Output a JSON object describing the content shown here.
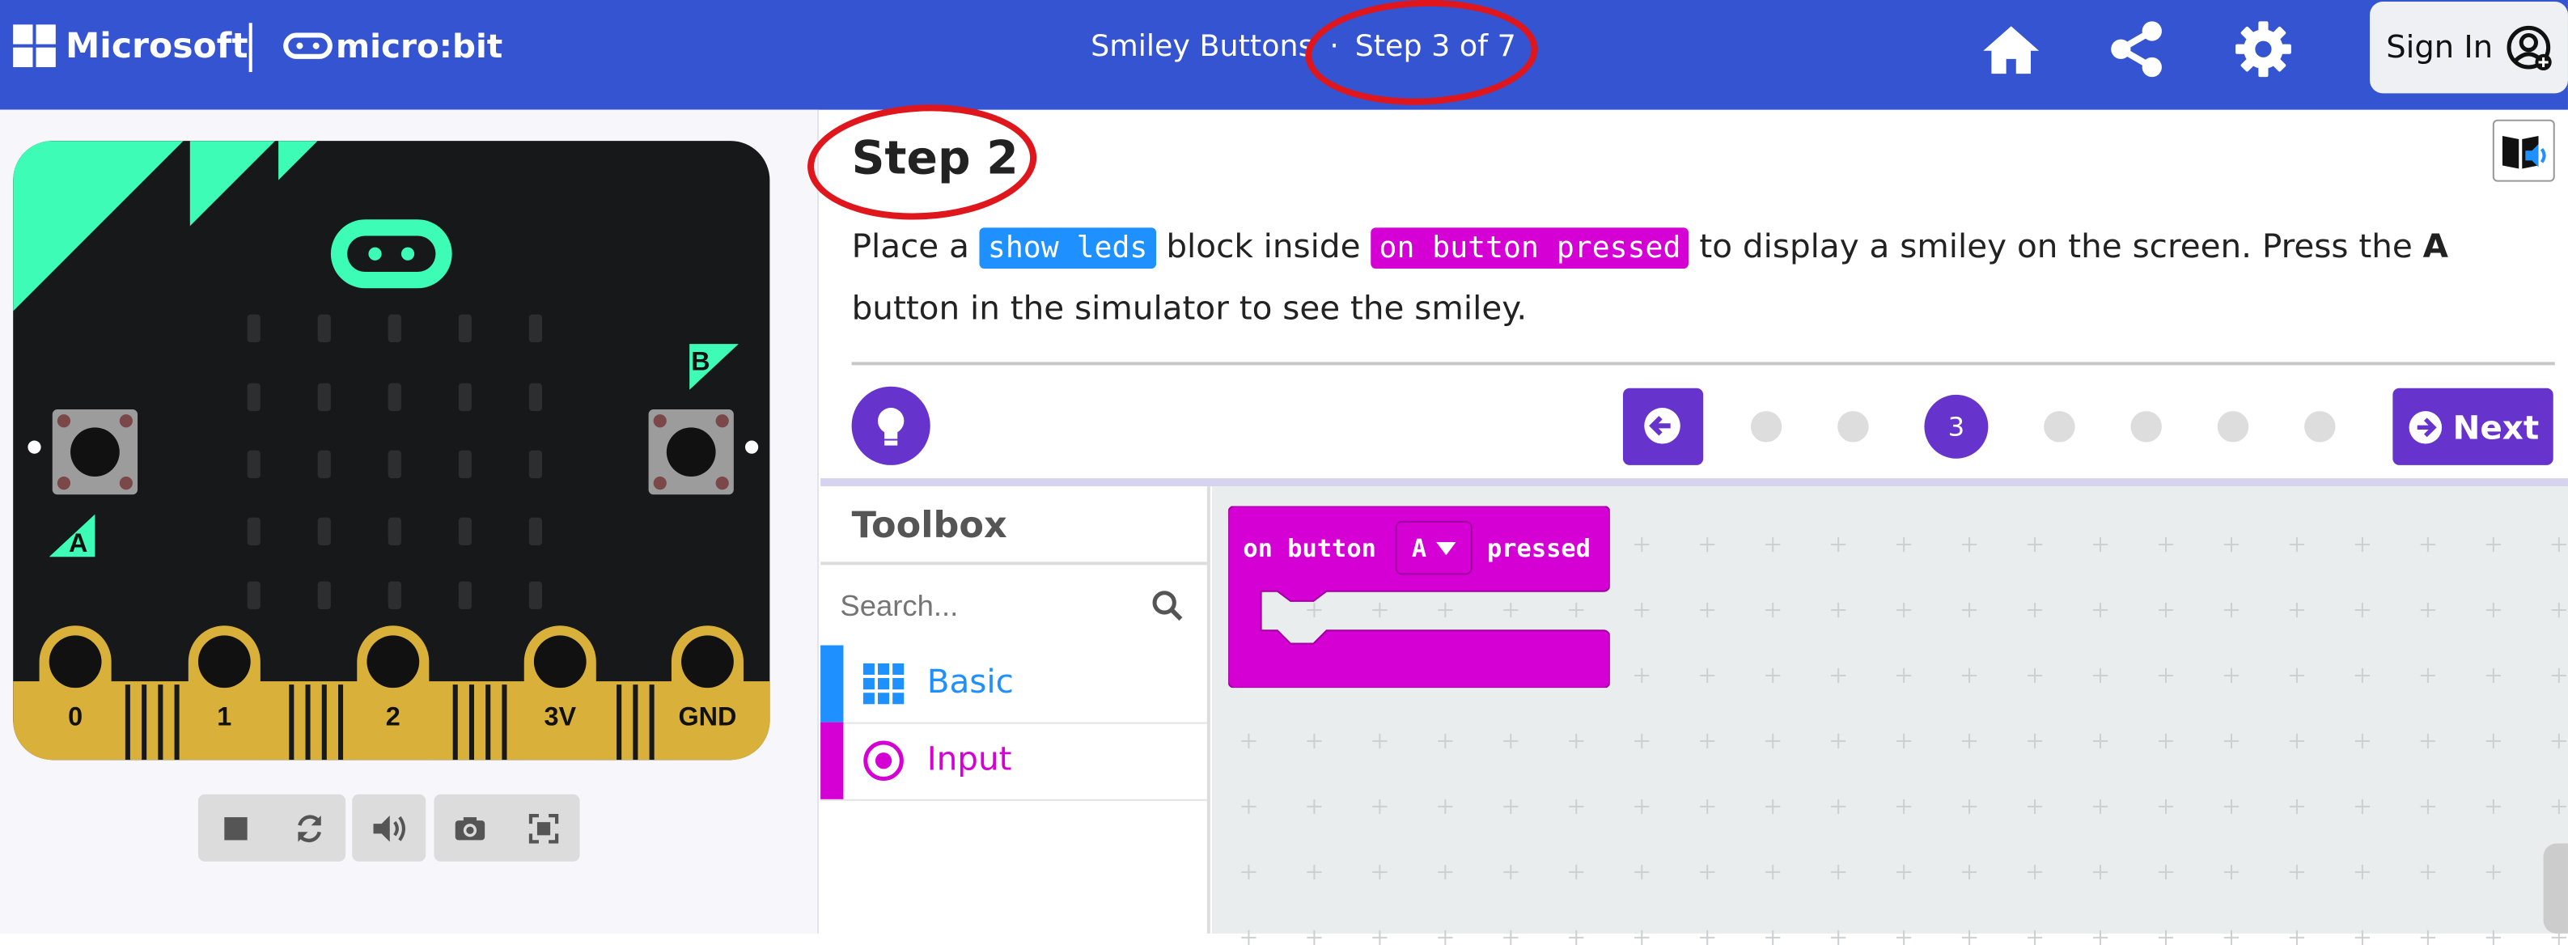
{
  "header": {
    "brand": "Microsoft",
    "product": "micro:bit",
    "tutorial_name": "Smiley Buttons",
    "separator": "·",
    "step_progress": "Step 3 of 7",
    "sign_in_label": "Sign In",
    "icons": [
      "home-icon",
      "share-icon",
      "settings-icon",
      "user-icon"
    ]
  },
  "simulator": {
    "button_a": "A",
    "button_b": "B",
    "pins": [
      "0",
      "1",
      "2",
      "3V",
      "GND"
    ],
    "controls": [
      "stop-icon",
      "restart-icon",
      "sound-icon",
      "screenshot-icon",
      "fullscreen-icon"
    ]
  },
  "tutorial": {
    "step_title": "Step 2",
    "text_1": "Place a ",
    "chip_1": "show leds",
    "text_2": " block inside ",
    "chip_2": "on button pressed",
    "text_3": " to display a smiley on the screen. Press the ",
    "bold_a": "A",
    "text_4": " button in the simulator to see the smiley.",
    "nav": {
      "current": "3",
      "total_dots": 7,
      "next_label": "Next"
    }
  },
  "toolbox": {
    "title": "Toolbox",
    "search_placeholder": "Search...",
    "categories": [
      {
        "label": "Basic",
        "color": "#1e90ff"
      },
      {
        "label": "Input",
        "color": "#d400d4"
      }
    ]
  },
  "workspace": {
    "block": {
      "text_1": "on button",
      "dropdown": "A",
      "text_2": "pressed",
      "color": "#d400d4"
    }
  },
  "annotations": {
    "color": "#e0161d"
  }
}
